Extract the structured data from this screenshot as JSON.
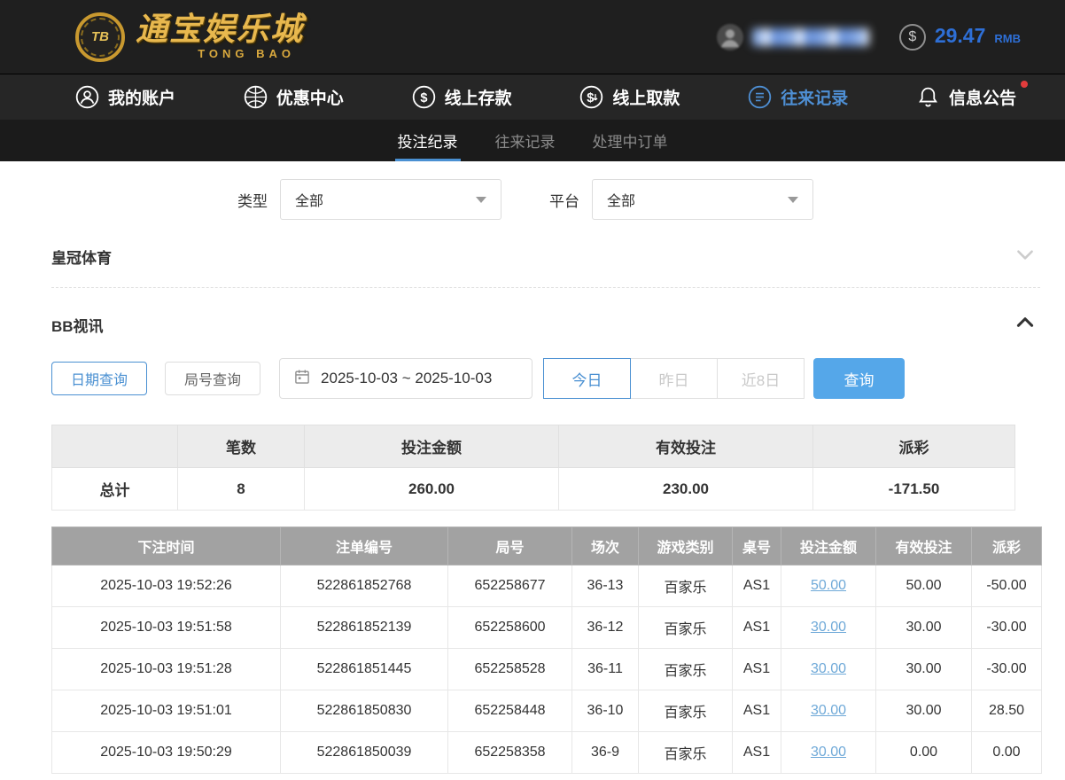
{
  "header": {
    "logo": {
      "chip_text": "TB",
      "title_cn": "通宝娱乐城",
      "title_en": "TONG BAO"
    },
    "balance": {
      "currency_symbol": "$",
      "amount": "29.47",
      "currency": "RMB"
    }
  },
  "nav": {
    "items": [
      {
        "label": "我的账户",
        "icon": "user-icon"
      },
      {
        "label": "优惠中心",
        "icon": "promo-icon"
      },
      {
        "label": "线上存款",
        "icon": "deposit-icon"
      },
      {
        "label": "线上取款",
        "icon": "withdraw-icon"
      },
      {
        "label": "往来记录",
        "icon": "records-icon"
      },
      {
        "label": "信息公告",
        "icon": "bell-icon"
      }
    ]
  },
  "subnav": {
    "tabs": [
      {
        "label": "投注纪录"
      },
      {
        "label": "往来记录"
      },
      {
        "label": "处理中订单"
      }
    ]
  },
  "filters": {
    "type_label": "类型",
    "type_value": "全部",
    "platform_label": "平台",
    "platform_value": "全部"
  },
  "sections": {
    "crown_sports_title": "皇冠体育",
    "bb_title": "BB视讯"
  },
  "query_bar": {
    "date_query": "日期查询",
    "round_query": "局号查询",
    "date_range": "2025-10-03 ~ 2025-10-03",
    "today": "今日",
    "yesterday": "昨日",
    "last_8_days": "近8日",
    "search": "查询"
  },
  "summary_table": {
    "headers": [
      "笔数",
      "投注金额",
      "有效投注",
      "派彩"
    ],
    "row_label": "总计",
    "count": "8",
    "bet_amount": "260.00",
    "valid_bet": "230.00",
    "payout": "-171.50"
  },
  "detail_table": {
    "headers": [
      "下注时间",
      "注单编号",
      "局号",
      "场次",
      "游戏类别",
      "桌号",
      "投注金额",
      "有效投注",
      "派彩"
    ],
    "rows": [
      {
        "time": "2025-10-03 19:52:26",
        "bet_no": "522861852768",
        "round_no": "652258677",
        "session": "36-13",
        "game_type": "百家乐",
        "table_no": "AS1",
        "bet_amount": "50.00",
        "valid_bet": "50.00",
        "payout": "-50.00"
      },
      {
        "time": "2025-10-03 19:51:58",
        "bet_no": "522861852139",
        "round_no": "652258600",
        "session": "36-12",
        "game_type": "百家乐",
        "table_no": "AS1",
        "bet_amount": "30.00",
        "valid_bet": "30.00",
        "payout": "-30.00"
      },
      {
        "time": "2025-10-03 19:51:28",
        "bet_no": "522861851445",
        "round_no": "652258528",
        "session": "36-11",
        "game_type": "百家乐",
        "table_no": "AS1",
        "bet_amount": "30.00",
        "valid_bet": "30.00",
        "payout": "-30.00"
      },
      {
        "time": "2025-10-03 19:51:01",
        "bet_no": "522861850830",
        "round_no": "652258448",
        "session": "36-10",
        "game_type": "百家乐",
        "table_no": "AS1",
        "bet_amount": "30.00",
        "valid_bet": "30.00",
        "payout": "28.50"
      },
      {
        "time": "2025-10-03 19:50:29",
        "bet_no": "522861850039",
        "round_no": "652258358",
        "session": "36-9",
        "game_type": "百家乐",
        "table_no": "AS1",
        "bet_amount": "30.00",
        "valid_bet": "0.00",
        "payout": "0.00"
      }
    ]
  },
  "colors": {
    "accent_blue": "#4a90d2",
    "gold": "#e8b84e",
    "negative_red": "#e05252",
    "link_blue": "#6fa9d8"
  }
}
